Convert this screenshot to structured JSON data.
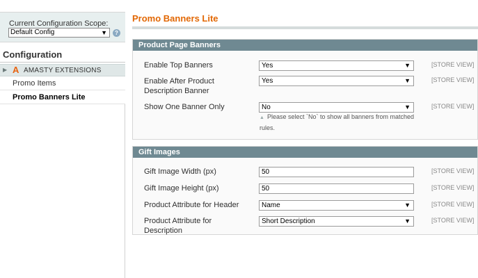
{
  "sidebar": {
    "scope_label": "Current Configuration Scope:",
    "scope_value": "Default Config",
    "help_icon": "?",
    "config_title": "Configuration",
    "extension_group": "AMASTY EXTENSIONS",
    "extension_logo": "A",
    "items": [
      {
        "label": "Promo Items",
        "active": false
      },
      {
        "label": "Promo Banners Lite",
        "active": true
      }
    ]
  },
  "main": {
    "page_title": "Promo Banners Lite",
    "sections": [
      {
        "title": "Product Page Banners",
        "rows": [
          {
            "label": "Enable Top Banners",
            "value": "Yes",
            "type": "select",
            "scope": "[STORE VIEW]"
          },
          {
            "label": "Enable After Product Description Banner",
            "value": "Yes",
            "type": "select",
            "scope": "[STORE VIEW]"
          },
          {
            "label": "Show One Banner Only",
            "value": "No",
            "type": "select",
            "scope": "[STORE VIEW]",
            "note": "Please select `No` to show all banners from matched rules."
          }
        ]
      },
      {
        "title": "Gift Images",
        "rows": [
          {
            "label": "Gift Image Width (px)",
            "value": "50",
            "type": "input",
            "scope": "[STORE VIEW]"
          },
          {
            "label": "Gift Image Height (px)",
            "value": "50",
            "type": "input",
            "scope": "[STORE VIEW]"
          },
          {
            "label": "Product Attribute for Header",
            "value": "Name",
            "type": "select",
            "scope": "[STORE VIEW]"
          },
          {
            "label": "Product Attribute for Description",
            "value": "Short Description",
            "type": "select",
            "scope": "[STORE VIEW]"
          }
        ]
      }
    ]
  },
  "icons": {
    "dropdown": "▼",
    "expand": "▶",
    "note": "▲"
  },
  "colors": {
    "title_orange": "#e26703",
    "section_header": "#6f8992",
    "scope_bg": "#e7efef"
  }
}
